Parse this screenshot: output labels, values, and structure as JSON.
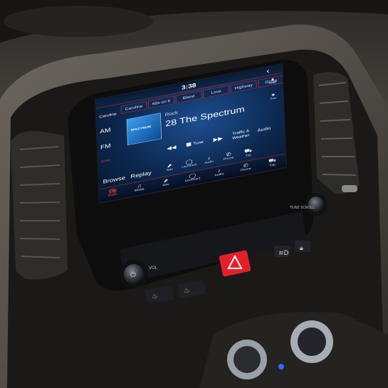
{
  "screen": {
    "time": "3:38",
    "back_symbol": "‹",
    "presets": [
      "Caroline",
      "60s on 6",
      "Blend",
      "Love",
      "Highway",
      "Ozzie"
    ],
    "side_left": {
      "am": "AM",
      "fm": "FM",
      "sxm": "SXM"
    },
    "side_right": {
      "map_label": "Map",
      "fav_label": "Fav"
    },
    "album_art_text": "SPECTRUM",
    "genre": "Rock",
    "station": "28 The Spectrum",
    "tools": {
      "tune_label": "Tune"
    },
    "traffic_label": "Traffic & Weather",
    "audio_label": "Audio",
    "browse_label": "Browse",
    "replay_label": "Replay",
    "icons": [
      "Nav",
      "Uconnect",
      "Audio",
      "Phone",
      "Trip"
    ],
    "nav": [
      {
        "label": "Radio",
        "icon": "radio-icon"
      },
      {
        "label": "Media",
        "icon": "media-icon"
      },
      {
        "label": "Nav",
        "icon": "nav-icon"
      },
      {
        "label": "Uconnect",
        "icon": "uconnect-icon"
      },
      {
        "label": "Audio",
        "icon": "audio-icon"
      },
      {
        "label": "Phone",
        "icon": "phone-icon"
      },
      {
        "label": "Trip",
        "icon": "trip-icon"
      }
    ]
  },
  "controls": {
    "vol_label": "VOL",
    "tune_label": "TUNE SCROLL"
  },
  "colors": {
    "accent_red": "#c12b2b",
    "hazard_red": "#e3202a",
    "screen_blue": "#0c2850"
  }
}
